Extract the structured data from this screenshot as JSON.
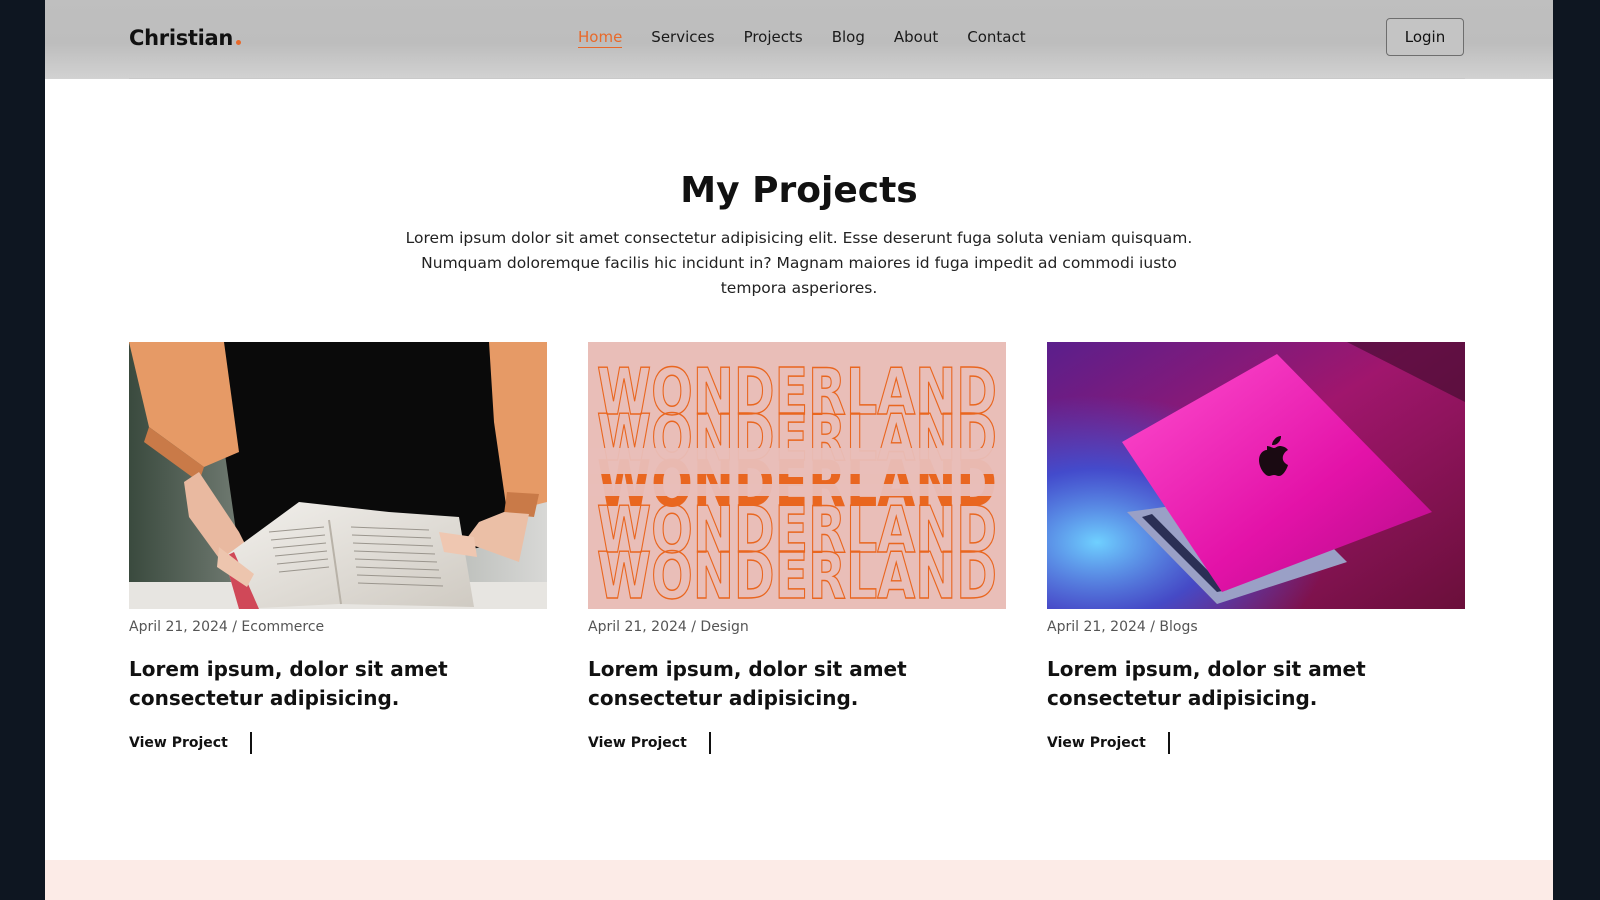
{
  "header": {
    "logo": "Christian",
    "nav": [
      {
        "label": "Home",
        "active": true
      },
      {
        "label": "Services",
        "active": false
      },
      {
        "label": "Projects",
        "active": false
      },
      {
        "label": "Blog",
        "active": false
      },
      {
        "label": "About",
        "active": false
      },
      {
        "label": "Contact",
        "active": false
      }
    ],
    "login_label": "Login"
  },
  "main": {
    "title": "My Projects",
    "intro": "Lorem ipsum dolor sit amet consectetur adipisicing elit. Esse deserunt fuga soluta veniam quisquam. Numquam doloremque facilis hic incidunt in? Magnam maiores id fuga impedit ad commodi iusto tempora asperiores.",
    "projects": [
      {
        "meta": "April 21, 2024 / Ecommerce",
        "title": "Lorem ipsum, dolor sit amet consectetur adipisicing.",
        "link": "View Project",
        "image": "person-reading-book"
      },
      {
        "meta": "April 21, 2024 / Design",
        "title": "Lorem ipsum, dolor sit amet consectetur adipisicing.",
        "link": "View Project",
        "image": "wonderland-typography",
        "image_text": "WONDERLAND"
      },
      {
        "meta": "April 21, 2024 / Blogs",
        "title": "Lorem ipsum, dolor sit amet consectetur adipisicing.",
        "link": "View Project",
        "image": "pink-laptop"
      }
    ]
  },
  "colors": {
    "accent": "#e8692a",
    "frame": "#0e1621",
    "band": "#fcebe7"
  }
}
